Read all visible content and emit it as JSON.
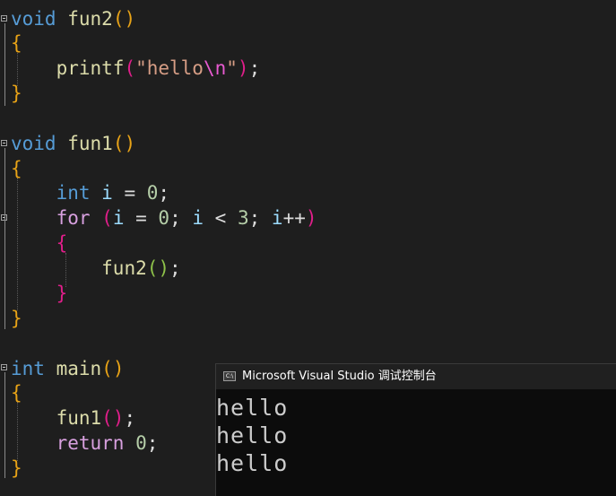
{
  "editor": {
    "lines": [
      {
        "tokens": [
          {
            "t": "void",
            "c": "kw"
          },
          {
            "t": " ",
            "c": "punct"
          },
          {
            "t": "fun2",
            "c": "fn"
          },
          {
            "t": "()",
            "c": "brace-gold"
          }
        ]
      },
      {
        "tokens": [
          {
            "t": "{",
            "c": "brace-gold"
          }
        ]
      },
      {
        "tokens": [
          {
            "t": "    ",
            "c": "punct"
          },
          {
            "t": "printf",
            "c": "fn"
          },
          {
            "t": "(",
            "c": "paren-pink"
          },
          {
            "t": "\"hello",
            "c": "str"
          },
          {
            "t": "\\n",
            "c": "esc"
          },
          {
            "t": "\"",
            "c": "str"
          },
          {
            "t": ")",
            "c": "paren-pink"
          },
          {
            "t": ";",
            "c": "punct"
          }
        ]
      },
      {
        "tokens": [
          {
            "t": "}",
            "c": "brace-gold"
          }
        ]
      },
      {
        "tokens": []
      },
      {
        "tokens": [
          {
            "t": "void",
            "c": "kw"
          },
          {
            "t": " ",
            "c": "punct"
          },
          {
            "t": "fun1",
            "c": "fn"
          },
          {
            "t": "()",
            "c": "brace-gold"
          }
        ]
      },
      {
        "tokens": [
          {
            "t": "{",
            "c": "brace-gold"
          }
        ]
      },
      {
        "tokens": [
          {
            "t": "    ",
            "c": "punct"
          },
          {
            "t": "int",
            "c": "kw"
          },
          {
            "t": " ",
            "c": "punct"
          },
          {
            "t": "i",
            "c": "var"
          },
          {
            "t": " = ",
            "c": "punct"
          },
          {
            "t": "0",
            "c": "num"
          },
          {
            "t": ";",
            "c": "punct"
          }
        ]
      },
      {
        "tokens": [
          {
            "t": "    ",
            "c": "punct"
          },
          {
            "t": "for",
            "c": "kwc"
          },
          {
            "t": " ",
            "c": "punct"
          },
          {
            "t": "(",
            "c": "paren-pink"
          },
          {
            "t": "i",
            "c": "var"
          },
          {
            "t": " = ",
            "c": "punct"
          },
          {
            "t": "0",
            "c": "num"
          },
          {
            "t": "; ",
            "c": "punct"
          },
          {
            "t": "i",
            "c": "var"
          },
          {
            "t": " < ",
            "c": "punct"
          },
          {
            "t": "3",
            "c": "num"
          },
          {
            "t": "; ",
            "c": "punct"
          },
          {
            "t": "i",
            "c": "var"
          },
          {
            "t": "++",
            "c": "punct"
          },
          {
            "t": ")",
            "c": "paren-pink"
          }
        ]
      },
      {
        "tokens": [
          {
            "t": "    ",
            "c": "punct"
          },
          {
            "t": "{",
            "c": "brace-pink"
          }
        ]
      },
      {
        "tokens": [
          {
            "t": "        ",
            "c": "punct"
          },
          {
            "t": "fun2",
            "c": "fn"
          },
          {
            "t": "()",
            "c": "paren-green"
          },
          {
            "t": ";",
            "c": "punct"
          }
        ]
      },
      {
        "tokens": [
          {
            "t": "    ",
            "c": "punct"
          },
          {
            "t": "}",
            "c": "brace-pink"
          }
        ]
      },
      {
        "tokens": [
          {
            "t": "}",
            "c": "brace-gold"
          }
        ]
      },
      {
        "tokens": []
      },
      {
        "tokens": [
          {
            "t": "int",
            "c": "kw"
          },
          {
            "t": " ",
            "c": "punct"
          },
          {
            "t": "main",
            "c": "fn"
          },
          {
            "t": "()",
            "c": "brace-gold"
          }
        ]
      },
      {
        "tokens": [
          {
            "t": "{",
            "c": "brace-gold"
          }
        ]
      },
      {
        "tokens": [
          {
            "t": "    ",
            "c": "punct"
          },
          {
            "t": "fun1",
            "c": "fn"
          },
          {
            "t": "()",
            "c": "paren-pink"
          },
          {
            "t": ";",
            "c": "punct"
          }
        ]
      },
      {
        "tokens": [
          {
            "t": "    ",
            "c": "punct"
          },
          {
            "t": "return",
            "c": "kwc"
          },
          {
            "t": " ",
            "c": "punct"
          },
          {
            "t": "0",
            "c": "num"
          },
          {
            "t": ";",
            "c": "punct"
          }
        ]
      },
      {
        "tokens": [
          {
            "t": "}",
            "c": "brace-gold"
          }
        ]
      }
    ]
  },
  "console": {
    "icon_label": "C:\\",
    "title": "Microsoft Visual Studio 调试控制台",
    "output": [
      "hello",
      "hello",
      "hello"
    ]
  },
  "colors": {
    "editor_bg": "#1e1e1e",
    "console_bg": "#0c0c0c",
    "keyword": "#569cd6",
    "control_keyword": "#d8a0df",
    "function": "#dcdcaa",
    "variable": "#9cdcfe",
    "number": "#b5cea8",
    "string": "#d69d85"
  },
  "icons": [
    "fold-toggle-icon",
    "console-app-icon"
  ]
}
